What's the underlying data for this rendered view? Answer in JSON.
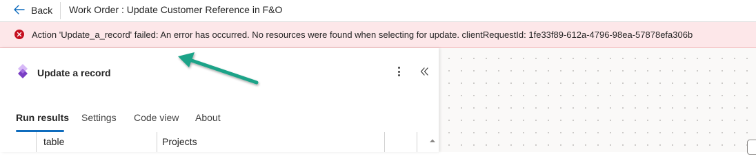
{
  "header": {
    "back_label": "Back",
    "flow_title": "Work Order : Update Customer Reference in F&O"
  },
  "error_banner": {
    "message": "Action 'Update_a_record' failed: An error has occurred. No resources were found when selecting for update. clientRequestId: 1fe33f89-612a-4796-98ea-57878efa306b",
    "color": "#c50f1f"
  },
  "panel": {
    "action_title": "Update a record",
    "action_icon": "power-apps-diamond-icon",
    "more_icon": "more-vertical-icon",
    "collapse_icon": "double-chevron-left-icon"
  },
  "tabs": [
    {
      "label": "Run results",
      "active": true
    },
    {
      "label": "Settings",
      "active": false
    },
    {
      "label": "Code view",
      "active": false
    },
    {
      "label": "About",
      "active": false
    }
  ],
  "table": {
    "row": {
      "key": "table",
      "value": "Projects"
    }
  },
  "colors": {
    "accent": "#0f6cbd",
    "annotation_arrow": "#1aa388",
    "error_bg": "#fde7e9"
  }
}
